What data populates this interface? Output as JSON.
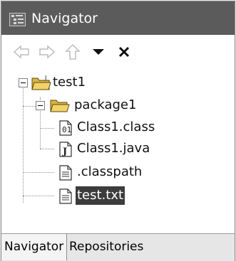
{
  "view": {
    "title": "Navigator",
    "title_icon": "navigator-view-icon"
  },
  "toolbar": {
    "back_icon": "back-arrow-icon",
    "forward_icon": "forward-arrow-icon",
    "up_icon": "up-arrow-icon",
    "menu_icon": "view-menu-triangle-icon",
    "close_icon": "close-icon"
  },
  "tree": {
    "project": "test1",
    "package": "package1",
    "class_file": "Class1.class",
    "java_file": "Class1.java",
    "classpath_file": ".classpath",
    "text_file": "test.txt"
  },
  "tabs": {
    "navigator": "Navigator",
    "repositories": "Repositories"
  },
  "colors": {
    "title_bar": "#5b5b5b",
    "selection": "#3c3c3c",
    "folder": "#e8c44a"
  }
}
